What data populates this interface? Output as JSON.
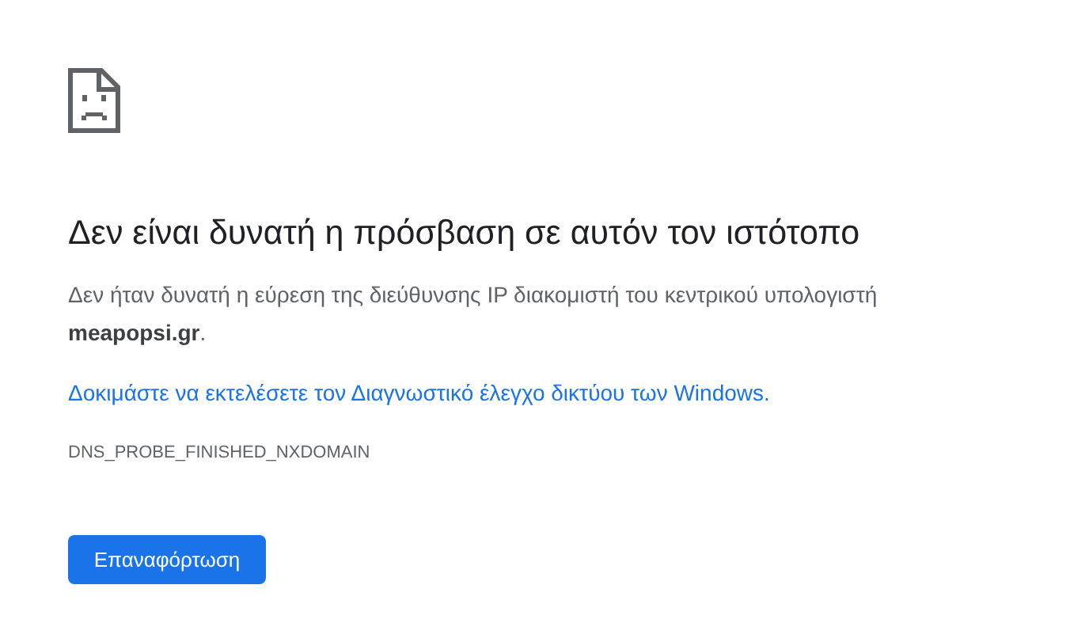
{
  "heading": "Δεν είναι δυνατή η πρόσβαση σε αυτόν τον ιστότοπο",
  "description": "Δεν ήταν δυνατή η εύρεση της διεύθυνσης IP διακομιστή του κεντρικού υπολογιστή **meapopsi.gr**.",
  "suggestion_link": "Δοκιμάστε να εκτελέσετε τον Διαγνωστικό έλεγχο δικτύου των Windows.",
  "error_code": "DNS_PROBE_FINISHED_NXDOMAIN",
  "buttons": [
    "Επαναφόρτωση"
  ]
}
